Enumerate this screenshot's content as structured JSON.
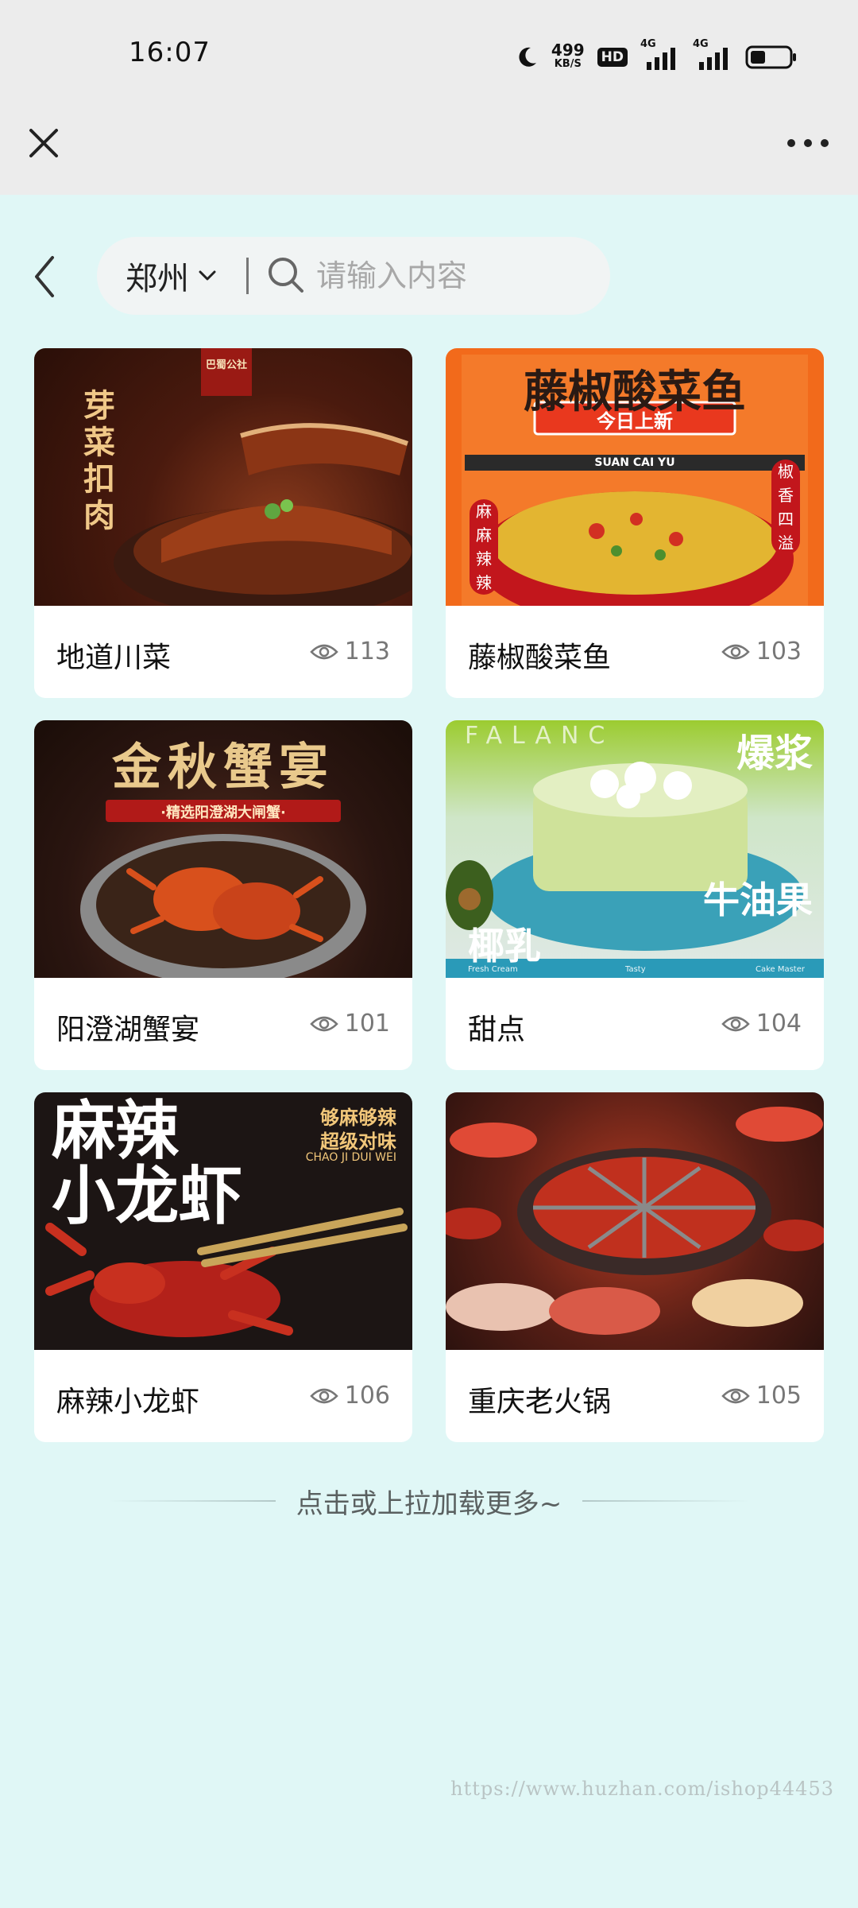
{
  "status_bar": {
    "time": "16:07",
    "net_speed": "499",
    "net_unit": "KB/S",
    "hd_badge": "HD",
    "sim1_label": "4G",
    "sim2_label": "4G"
  },
  "search": {
    "city": "郑州",
    "placeholder": "请输入内容"
  },
  "cards": [
    {
      "title": "地道川菜",
      "views": "113",
      "poster": {
        "line1": "芽菜扣肉",
        "tag": "巴蜀公社"
      }
    },
    {
      "title": "藤椒酸菜鱼",
      "views": "103",
      "poster": {
        "line1": "藤椒酸菜鱼",
        "line2": "今日上新",
        "ribbon": "SUAN CAI YU",
        "left_tag": "麻麻辣辣",
        "right_tag": "椒香四溢"
      }
    },
    {
      "title": "阳澄湖蟹宴",
      "views": "101",
      "poster": {
        "line1": "金秋蟹宴",
        "line2": "·精选阳澄湖大闸蟹·"
      }
    },
    {
      "title": "甜点",
      "views": "104",
      "poster": {
        "brand": "FALANC",
        "line1": "爆浆",
        "line2": "椰乳",
        "line3": "牛油果",
        "foot1": "Fresh Cream",
        "foot2": "Tasty",
        "foot3": "Cake Master"
      }
    },
    {
      "title": "麻辣小龙虾",
      "views": "106",
      "poster": {
        "line1": "麻辣",
        "line2": "小龙虾",
        "side1": "够麻够辣",
        "side2": "超级对味",
        "side3": "CHAO JI DUI WEI"
      }
    },
    {
      "title": "重庆老火锅",
      "views": "105",
      "poster": {}
    }
  ],
  "load_more": "点击或上拉加载更多~",
  "watermark": "https://www.huzhan.com/ishop44453",
  "colors": {
    "page_bg": "#e0f7f6",
    "header_bg": "#ececec",
    "card_bg": "#ffffff",
    "text_primary": "#111111",
    "text_muted": "#777777"
  }
}
